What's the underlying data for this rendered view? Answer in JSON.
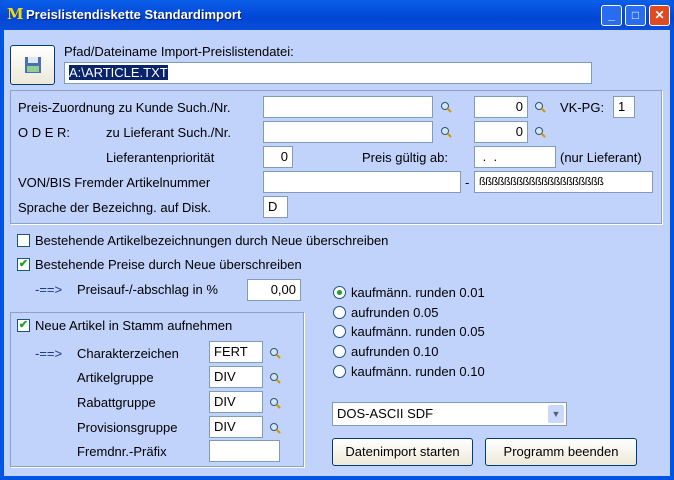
{
  "window": {
    "title": "Preislistendiskette Standardimport",
    "logo": "M",
    "minimize": "_",
    "maximize": "□",
    "close": "✕"
  },
  "file": {
    "label": "Pfad/Dateiname Import-Preislistendatei:",
    "value": "A:\\ARTICLE.TXT"
  },
  "assign": {
    "kunde_label": "Preis-Zuordnung zu Kunde Such./Nr.",
    "kunde_search": "",
    "kunde_nr": "0",
    "vkpg_label": "VK-PG:",
    "vkpg": "1",
    "oder_label": "O D E R:",
    "lieferant_label": "zu Lieferant Such./Nr.",
    "lieferant_search": "",
    "lieferant_nr": "0",
    "prio_label": "Lieferantenpriorität",
    "prio": "0",
    "gueltig_label": "Preis gültig ab:",
    "gueltig": " .  .",
    "nur_lieferant": "(nur Lieferant)",
    "vonbis_label": "VON/BIS Fremder Artikelnummer",
    "von": "",
    "dash": "-",
    "bis": "ßßßßßßßßßßßßßßßßßßßß",
    "sprache_label": "Sprache der Bezeichng. auf Disk.",
    "sprache": "D"
  },
  "options": {
    "overwrite_desc": {
      "label": "Bestehende Artikelbezeichnungen durch Neue überschreiben",
      "checked": false
    },
    "overwrite_prices": {
      "label": "Bestehende Preise durch Neue überschreiben",
      "checked": true
    },
    "arrow": "-==>",
    "aufschlag_label": "Preisauf-/-abschlag in %",
    "aufschlag": "0,00"
  },
  "new_articles": {
    "label": "Neue Artikel in Stamm aufnehmen",
    "checked": true,
    "arrow": "-==>",
    "fields": [
      {
        "label": "Charakterzeichen",
        "value": "FERT"
      },
      {
        "label": "Artikelgruppe",
        "value": "DIV"
      },
      {
        "label": "Rabattgruppe",
        "value": "DIV"
      },
      {
        "label": "Provisionsgruppe",
        "value": "DIV"
      },
      {
        "label": "Fremdnr.-Präfix",
        "value": ""
      }
    ]
  },
  "rounding": {
    "selected": 0,
    "options": [
      "kaufmänn. runden 0.01",
      "aufrunden 0.05",
      "kaufmänn. runden 0.05",
      "aufrunden 0.10",
      "kaufmänn. runden 0.10"
    ]
  },
  "format": {
    "value": "DOS-ASCII SDF"
  },
  "buttons": {
    "start": "Datenimport starten",
    "exit": "Programm beenden"
  },
  "colors": {
    "bg": "#c1d2fb",
    "title": "#0054e3",
    "selection": "#0a246a"
  }
}
